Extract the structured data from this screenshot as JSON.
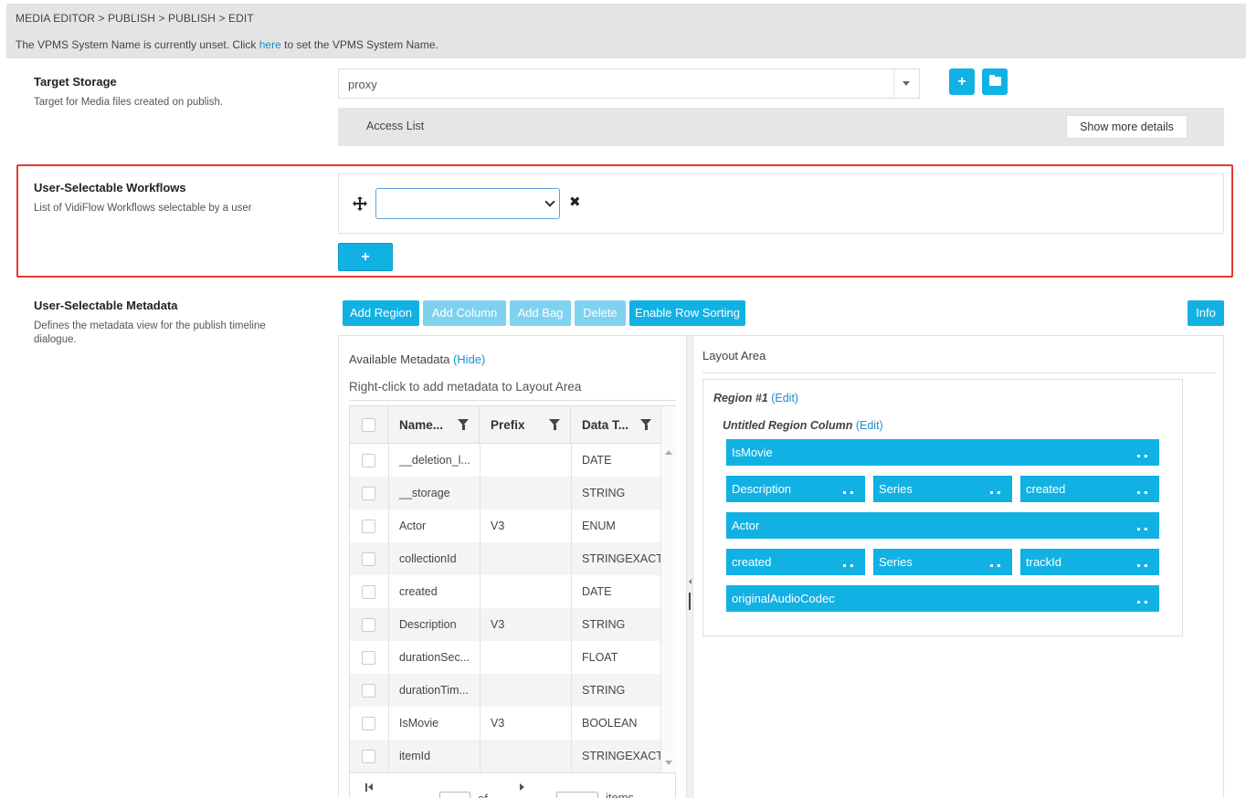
{
  "breadcrumb": "MEDIA EDITOR > PUBLISH > PUBLISH > EDIT",
  "system_message": {
    "before": "The VPMS System Name is currently unset. Click ",
    "link": "here",
    "after": " to set the VPMS System Name."
  },
  "target_storage": {
    "title": "Target Storage",
    "description": "Target for Media files created on publish.",
    "value": "proxy",
    "access_list_label": "Access List",
    "show_more_label": "Show more details"
  },
  "workflows": {
    "title": "User-Selectable Workflows",
    "description": "List of VidiFlow Workflows selectable by a user",
    "selected": "",
    "add_label": "+"
  },
  "metadata": {
    "title": "User-Selectable Metadata",
    "description": "Defines the metadata view for the publish timeline dialogue.",
    "toolbar": {
      "add_region": "Add Region",
      "add_column": "Add Column",
      "add_bag": "Add Bag",
      "delete": "Delete",
      "enable_row_sorting": "Enable Row Sorting",
      "info": "Info"
    },
    "available": {
      "title": "Available Metadata",
      "hide_link": "(Hide)",
      "hint": "Right-click to add metadata to Layout Area",
      "columns": [
        "Name...",
        "Prefix",
        "Data T..."
      ],
      "rows": [
        {
          "name": "__deletion_l...",
          "prefix": "",
          "type": "DATE"
        },
        {
          "name": "__storage",
          "prefix": "",
          "type": "STRING"
        },
        {
          "name": "Actor",
          "prefix": "V3",
          "type": "ENUM"
        },
        {
          "name": "collectionId",
          "prefix": "",
          "type": "STRINGEXACT"
        },
        {
          "name": "created",
          "prefix": "",
          "type": "DATE"
        },
        {
          "name": "Description",
          "prefix": "V3",
          "type": "STRING"
        },
        {
          "name": "durationSec...",
          "prefix": "",
          "type": "FLOAT"
        },
        {
          "name": "durationTim...",
          "prefix": "",
          "type": "STRING"
        },
        {
          "name": "IsMovie",
          "prefix": "V3",
          "type": "BOOLEAN"
        },
        {
          "name": "itemId",
          "prefix": "",
          "type": "STRINGEXACT"
        }
      ],
      "pager": {
        "of_label": "of",
        "items_label": "items"
      }
    },
    "layout": {
      "title": "Layout Area",
      "region_title": "Region #1",
      "edit_label": "(Edit)",
      "column_title": "Untitled Region Column",
      "rows": [
        [
          "IsMovie"
        ],
        [
          "Description",
          "Series",
          "created"
        ],
        [
          "Actor"
        ],
        [
          "created",
          "Series",
          "trackId"
        ],
        [
          "originalAudioCodec"
        ]
      ]
    }
  },
  "colors": {
    "accent": "#11b1e4",
    "highlight": "#e53935",
    "link": "#1a8fd1"
  }
}
